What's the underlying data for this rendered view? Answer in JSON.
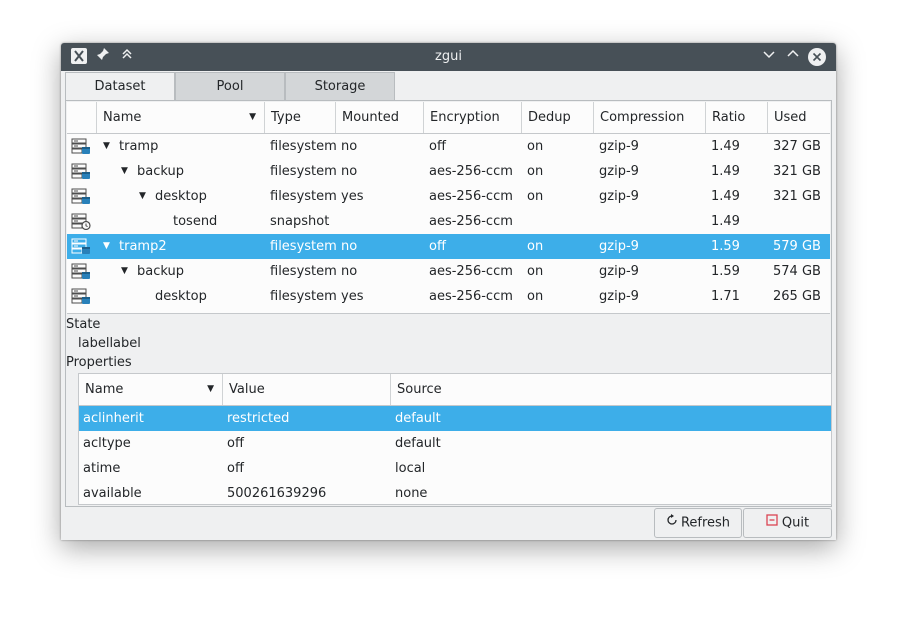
{
  "window": {
    "title": "zgui"
  },
  "tabs": [
    {
      "label": "Dataset",
      "active": true
    },
    {
      "label": "Pool",
      "active": false
    },
    {
      "label": "Storage",
      "active": false
    }
  ],
  "datasets": {
    "columns": [
      "Name",
      "Type",
      "Mounted",
      "Encryption",
      "Dedup",
      "Compression",
      "Ratio",
      "Used"
    ],
    "rows": [
      {
        "name": "tramp",
        "type": "filesystem",
        "mounted": "no",
        "encryption": "off",
        "dedup": "on",
        "compression": "gzip-9",
        "ratio": "1.49",
        "used": "327 GB",
        "icon": "filesystem-icon"
      },
      {
        "name": "backup",
        "type": "filesystem",
        "mounted": "no",
        "encryption": "aes-256-ccm",
        "dedup": "on",
        "compression": "gzip-9",
        "ratio": "1.49",
        "used": "321 GB",
        "icon": "filesystem-icon"
      },
      {
        "name": "desktop",
        "type": "filesystem",
        "mounted": "yes",
        "encryption": "aes-256-ccm",
        "dedup": "on",
        "compression": "gzip-9",
        "ratio": "1.49",
        "used": "321 GB",
        "icon": "filesystem-icon"
      },
      {
        "name": "tosend",
        "type": "snapshot",
        "mounted": "",
        "encryption": "aes-256-ccm",
        "dedup": "",
        "compression": "",
        "ratio": "1.49",
        "used": "",
        "icon": "snapshot-icon"
      },
      {
        "name": "tramp2",
        "type": "filesystem",
        "mounted": "no",
        "encryption": "off",
        "dedup": "on",
        "compression": "gzip-9",
        "ratio": "1.59",
        "used": "579 GB",
        "icon": "filesystem-icon",
        "selected": true
      },
      {
        "name": "backup",
        "type": "filesystem",
        "mounted": "no",
        "encryption": "aes-256-ccm",
        "dedup": "on",
        "compression": "gzip-9",
        "ratio": "1.59",
        "used": "574 GB",
        "icon": "filesystem-icon"
      },
      {
        "name": "desktop",
        "type": "filesystem",
        "mounted": "yes",
        "encryption": "aes-256-ccm",
        "dedup": "on",
        "compression": "gzip-9",
        "ratio": "1.71",
        "used": "265 GB",
        "icon": "filesystem-icon"
      }
    ]
  },
  "state": {
    "heading": "State",
    "value": "labellabel"
  },
  "properties": {
    "heading": "Properties",
    "columns": [
      "Name",
      "Value",
      "Source"
    ],
    "rows": [
      {
        "name": "aclinherit",
        "value": "restricted",
        "source": "default",
        "selected": true
      },
      {
        "name": "acltype",
        "value": "off",
        "source": "default"
      },
      {
        "name": "atime",
        "value": "off",
        "source": "local"
      },
      {
        "name": "available",
        "value": "500261639296",
        "source": "none"
      }
    ]
  },
  "buttons": {
    "refresh": "Refresh",
    "quit": "Quit"
  },
  "colors": {
    "titlebar": "#475057",
    "selection": "#3daee9",
    "window_bg": "#eff0f1",
    "quit_icon": "#da4453"
  }
}
